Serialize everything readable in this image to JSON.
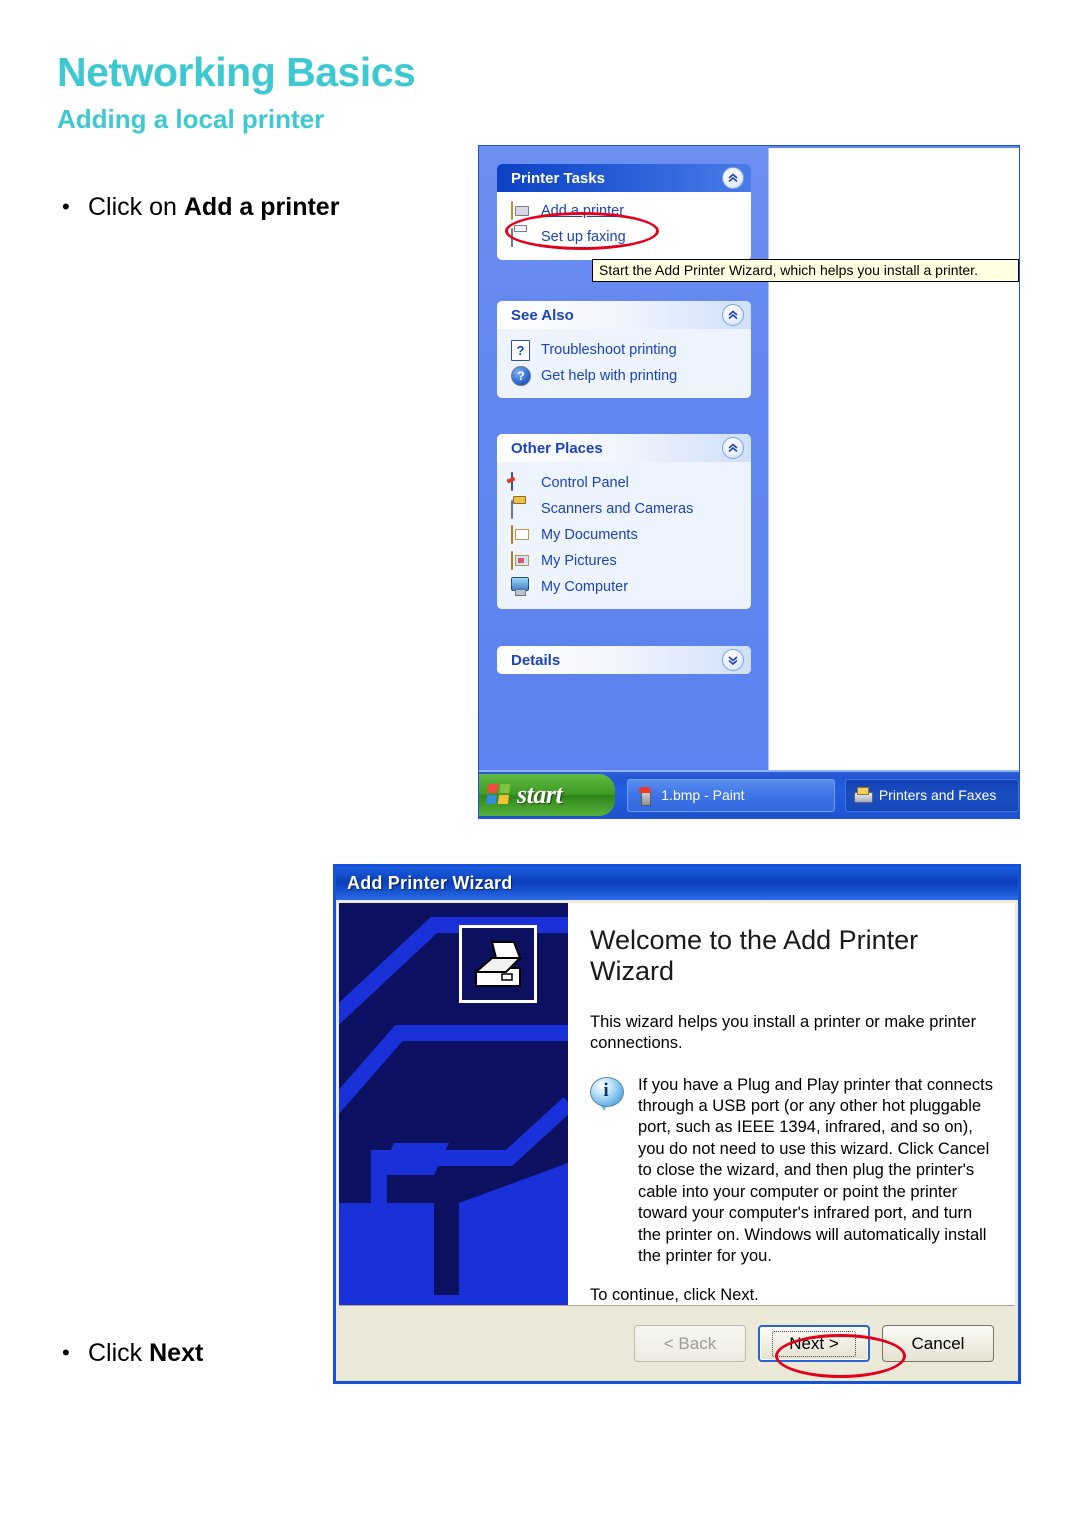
{
  "header": {
    "title": "Networking Basics",
    "subtitle": "Adding a local printer",
    "accent_color": "#3ec8d2"
  },
  "instructions": [
    {
      "bullet": "•",
      "text_before": "Click on ",
      "text_bold": "Add a printer",
      "text_after": ""
    },
    {
      "bullet": "•",
      "text_before": "Click ",
      "text_bold": "Next",
      "text_after": ""
    }
  ],
  "printers_window": {
    "task_groups": [
      {
        "title": "Printer Tasks",
        "chevron": "chevron-up-icon",
        "style": "blue",
        "items": [
          {
            "label": "Add a printer",
            "icon": "add-printer-icon",
            "link": true,
            "highlighted": true
          },
          {
            "label": "Set up faxing",
            "icon": "fax-icon",
            "link": false,
            "highlighted": false
          }
        ]
      },
      {
        "title": "See Also",
        "chevron": "chevron-up-icon",
        "style": "light",
        "items": [
          {
            "label": "Troubleshoot printing",
            "icon": "help-document-icon",
            "link": false,
            "highlighted": false
          },
          {
            "label": "Get help with printing",
            "icon": "help-circle-icon",
            "link": false,
            "highlighted": false
          }
        ]
      },
      {
        "title": "Other Places",
        "chevron": "chevron-up-icon",
        "style": "light",
        "items": [
          {
            "label": "Control Panel",
            "icon": "control-panel-icon",
            "link": false,
            "highlighted": false
          },
          {
            "label": "Scanners and Cameras",
            "icon": "scanner-icon",
            "link": false,
            "highlighted": false
          },
          {
            "label": "My Documents",
            "icon": "folder-documents-icon",
            "link": false,
            "highlighted": false
          },
          {
            "label": "My Pictures",
            "icon": "folder-pictures-icon",
            "link": false,
            "highlighted": false
          },
          {
            "label": "My Computer",
            "icon": "my-computer-icon",
            "link": false,
            "highlighted": false
          }
        ]
      },
      {
        "title": "Details",
        "chevron": "chevron-down-icon",
        "style": "light",
        "items": []
      }
    ],
    "tooltip": "Start the Add Printer Wizard, which helps you install a printer.",
    "taskbar": {
      "start_label": "start",
      "items": [
        {
          "label": "1.bmp - Paint",
          "icon": "paint-icon",
          "active": false
        },
        {
          "label": "Printers and Faxes",
          "icon": "printer-icon",
          "active": true
        }
      ]
    }
  },
  "wizard": {
    "title": "Add Printer Wizard",
    "heading": "Welcome to the Add Printer Wizard",
    "intro": "This wizard helps you install a printer or make printer connections.",
    "note_icon": "info-icon",
    "note": "If you have a Plug and Play printer that connects through a USB port (or any other hot pluggable port, such as IEEE 1394, infrared, and so on), you do not need to use this wizard. Click Cancel to close the wizard, and then plug the printer's cable into your computer or point the printer toward your computer's infrared port, and turn the printer on. Windows will automatically install the printer for you.",
    "continue": "To continue, click Next.",
    "buttons": {
      "back": "< Back",
      "next": "Next >",
      "cancel": "Cancel"
    }
  },
  "annotations": {
    "ellipse_color": "#e3001b",
    "targets": [
      "add-a-printer-link",
      "next-button"
    ]
  }
}
